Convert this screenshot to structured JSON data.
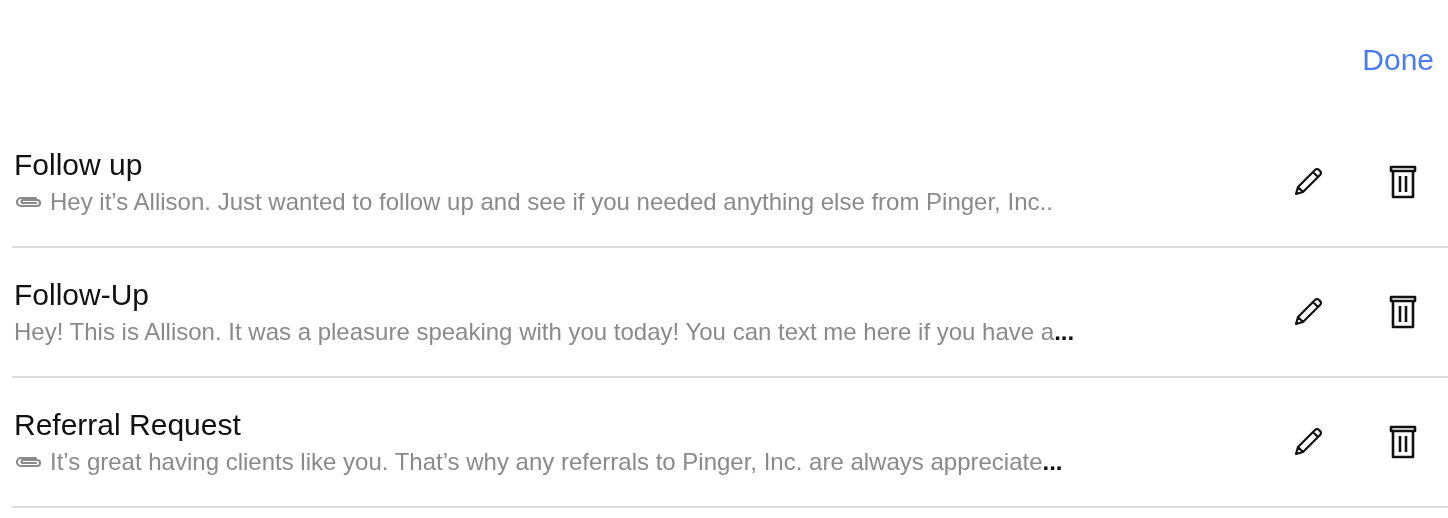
{
  "header": {
    "done_label": "Done"
  },
  "templates": [
    {
      "title": "Follow up",
      "attachment": true,
      "preview": "Hey it’s Allison. Just wanted to follow up and see if you needed anything else from Pinger, Inc.."
    },
    {
      "title": "Follow-Up",
      "attachment": false,
      "preview": "Hey! This is Allison. It was a pleasure speaking with you today! You can text me here if you have a",
      "ellipsis": "..."
    },
    {
      "title": "Referral Request",
      "attachment": true,
      "preview": "It’s great having clients like you. That’s why any referrals to Pinger, Inc. are always appreciate",
      "ellipsis": "..."
    }
  ]
}
